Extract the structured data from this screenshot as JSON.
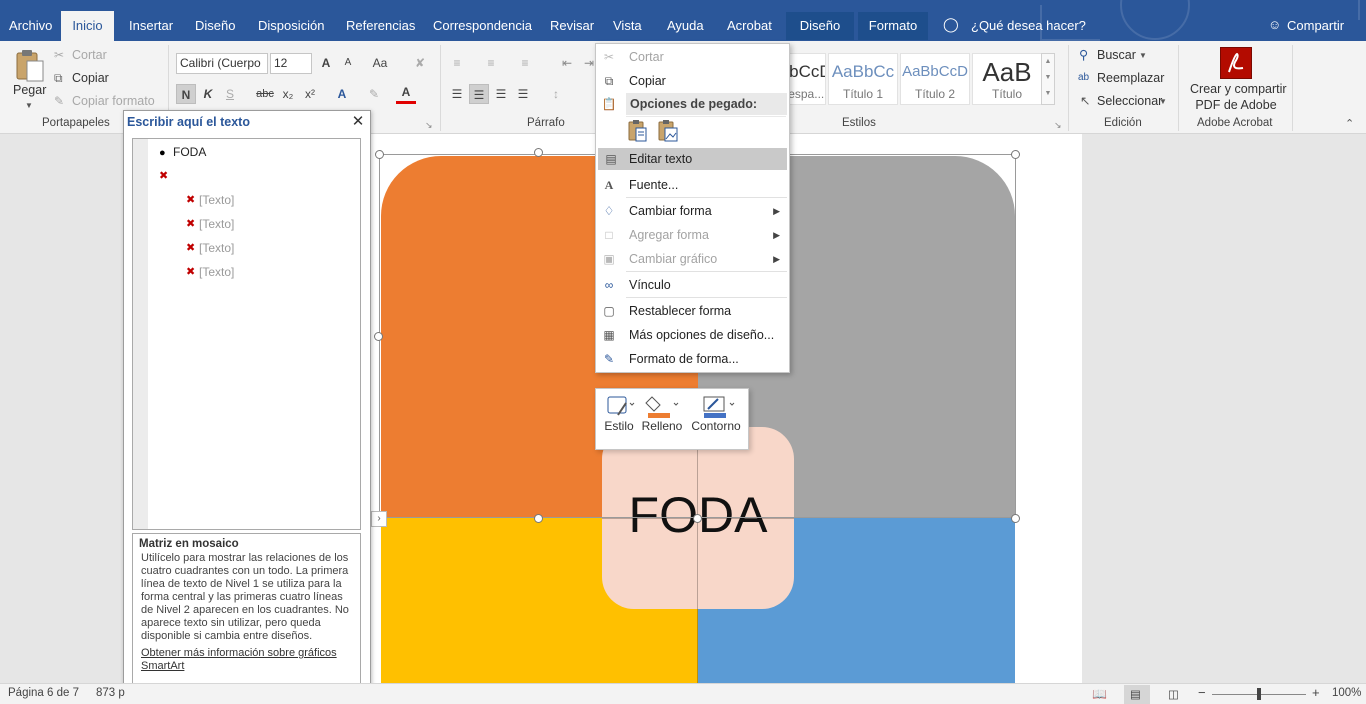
{
  "tabs": [
    {
      "label": "Archivo"
    },
    {
      "label": "Inicio"
    },
    {
      "label": "Insertar"
    },
    {
      "label": "Diseño"
    },
    {
      "label": "Disposición"
    },
    {
      "label": "Referencias"
    },
    {
      "label": "Correspondencia"
    },
    {
      "label": "Revisar"
    },
    {
      "label": "Vista"
    },
    {
      "label": "Ayuda"
    },
    {
      "label": "Acrobat"
    },
    {
      "label": "Diseño"
    },
    {
      "label": "Formato"
    }
  ],
  "tellme": "¿Qué desea hacer?",
  "share": "Compartir",
  "clipboard": {
    "paste": "Pegar",
    "cut": "Cortar",
    "copy": "Copiar",
    "format_painter": "Copiar formato",
    "group": "Portapapeles"
  },
  "font": {
    "name": "Calibri (Cuerpo",
    "size": "12",
    "case": "Aa",
    "strike": "abc"
  },
  "paragraph_group": "Párrafo",
  "styles": {
    "tiles": [
      {
        "preview": "AaBbCcD",
        "name": "¶ Sin espa..."
      },
      {
        "preview": "AaBbCc",
        "name": "Título 1"
      },
      {
        "preview": "AaBbCcD",
        "name": "Título 2"
      },
      {
        "preview": "AaB",
        "name": "Título"
      }
    ],
    "group": "Estilos"
  },
  "editing": {
    "find": "Buscar",
    "replace": "Reemplazar",
    "select": "Seleccionar",
    "group": "Edición"
  },
  "acrobat": {
    "line1": "Crear y compartir",
    "line2": "PDF de Adobe",
    "group": "Adobe Acrobat"
  },
  "text_pane": {
    "title": "Escribir aquí el texto",
    "items": [
      {
        "text": "FODA",
        "level": 1
      },
      {
        "text": "",
        "level": 1
      },
      {
        "text": "[Texto]",
        "level": 2
      },
      {
        "text": "[Texto]",
        "level": 2
      },
      {
        "text": "[Texto]",
        "level": 2
      },
      {
        "text": "[Texto]",
        "level": 2
      }
    ],
    "desc_title": "Matriz en mosaico",
    "desc_body": "Utilícelo para mostrar las relaciones de los cuatro cuadrantes con un todo. La primera línea de texto de Nivel 1 se utiliza para la forma central y las primeras cuatro líneas de Nivel 2 aparecen en los cuadrantes. No aparece texto sin utilizar, pero queda disponible si cambia entre diseños.",
    "desc_link": "Obtener más información sobre gráficos SmartArt"
  },
  "smartart": {
    "center_text": "FODA",
    "colors": {
      "orange": "#ed7d31",
      "gray": "#a5a5a5",
      "yellow": "#ffc000",
      "blue": "#5b9bd5",
      "center": "#f8d7c9"
    }
  },
  "context_menu": {
    "items": [
      {
        "label": "Cortar",
        "icon": "scissors-icon",
        "disabled": true
      },
      {
        "label": "Copiar",
        "icon": "copy-icon",
        "disabled": false
      },
      {
        "label": "Opciones de pegado:",
        "icon": "paste-icon",
        "disabled": false
      },
      {
        "label": "Editar texto",
        "icon": "edit-text-icon",
        "disabled": false
      },
      {
        "label": "Fuente...",
        "icon": "font-icon",
        "disabled": false
      },
      {
        "label": "Cambiar forma",
        "icon": "change-shape-icon",
        "disabled": false
      },
      {
        "label": "Agregar forma",
        "icon": "add-shape-icon",
        "disabled": true
      },
      {
        "label": "Cambiar gráfico",
        "icon": "change-graphic-icon",
        "disabled": true
      },
      {
        "label": "Vínculo",
        "icon": "link-icon",
        "disabled": false
      },
      {
        "label": "Restablecer forma",
        "icon": "reset-shape-icon",
        "disabled": false
      },
      {
        "label": "Más opciones de diseño...",
        "icon": "layout-options-icon",
        "disabled": false
      },
      {
        "label": "Formato de forma...",
        "icon": "format-shape-icon",
        "disabled": false
      }
    ]
  },
  "mini_toolbar": {
    "style": "Estilo",
    "fill": "Relleno",
    "outline": "Contorno"
  },
  "status_bar": {
    "page": "Página 6 de 7",
    "words": "873 p",
    "zoom": "100%"
  }
}
